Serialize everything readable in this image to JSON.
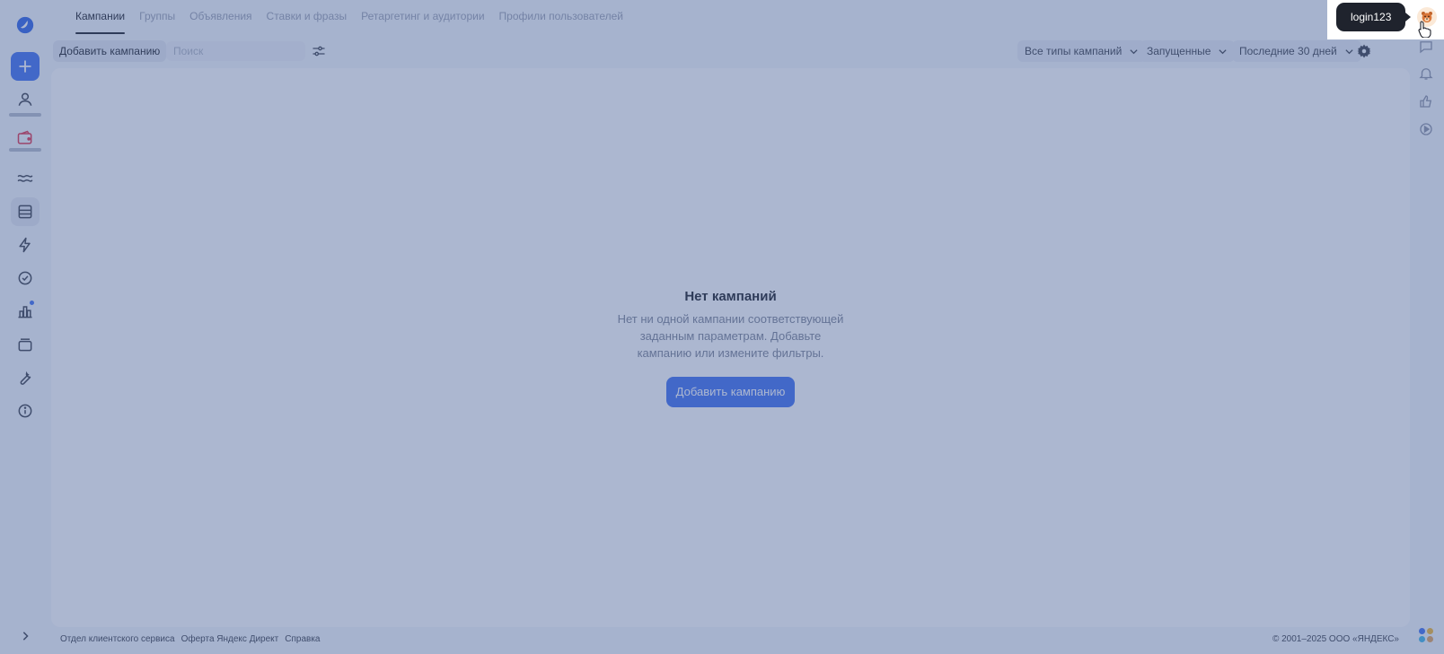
{
  "tabs": [
    {
      "label": "Кампании",
      "active": true
    },
    {
      "label": "Группы"
    },
    {
      "label": "Объявления"
    },
    {
      "label": "Ставки и фразы"
    },
    {
      "label": "Ретаргетинг и аудитории"
    },
    {
      "label": "Профили пользователей"
    }
  ],
  "toolbar": {
    "add_campaign": "Добавить кампанию",
    "search_placeholder": "Поиск",
    "campaign_types": "Все типы кампаний",
    "status": "Запущенные",
    "period": "Последние 30 дней"
  },
  "empty_state": {
    "title": "Нет кампаний",
    "text": "Нет ни одной кампании соответствующей заданным параметрам. Добавьте кампанию или измените фильтры.",
    "button": "Добавить кампанию"
  },
  "tooltip": {
    "text": "login123"
  },
  "footer": {
    "links": [
      "Отдел клиентского сервиса",
      "Оферта Яндекс Директ",
      "Справка"
    ],
    "copyright": "© 2001–2025 ООО «ЯНДЕКС»"
  },
  "colors": {
    "accent": "#3f6ff0",
    "overlay": "#465f96",
    "tooltip_bg": "#1f232d"
  },
  "icons": {
    "rail": [
      "yandex-direct-logo-icon",
      "plus-icon",
      "user-icon",
      "wallet-icon",
      "waves-icon",
      "campaigns-list-icon",
      "lightning-icon",
      "check-circle-icon",
      "stats-chart-icon",
      "layers-icon",
      "wrench-icon",
      "info-icon",
      "chevron-right-icon"
    ],
    "right_rail": [
      "chat-icon",
      "bell-icon",
      "thumbs-up-icon",
      "play-icon"
    ]
  }
}
